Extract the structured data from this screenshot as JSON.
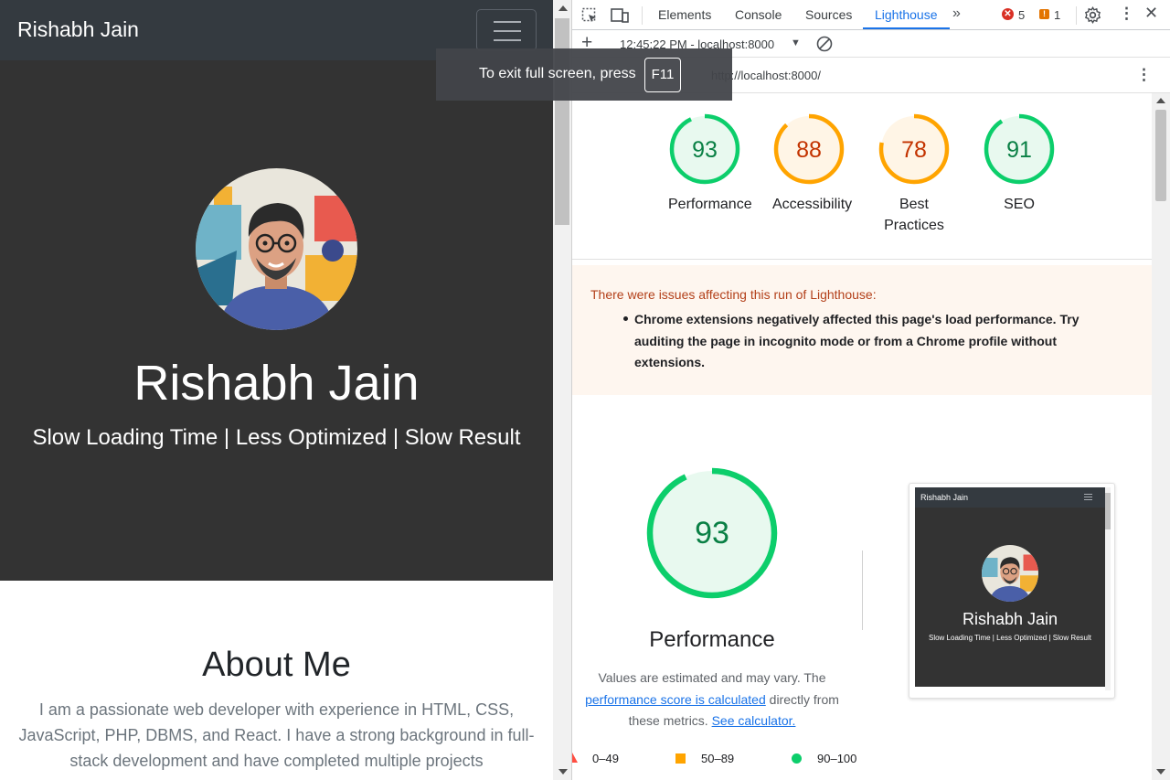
{
  "site": {
    "brand": "Rishabh Jain",
    "hero_name": "Rishabh Jain",
    "hero_tagline": "Slow Loading Time | Less Optimized | Slow Result",
    "about_title": "About Me",
    "about_text": "I am a passionate web developer with experience in HTML, CSS, JavaScript, PHP, DBMS, and React. I have a strong background in full-stack development and have completed multiple projects"
  },
  "fullscreen_toast": {
    "text": "To exit full screen, press",
    "key": "F11"
  },
  "devtools": {
    "tabs": [
      "Elements",
      "Console",
      "Sources",
      "Lighthouse"
    ],
    "active_tab": "Lighthouse",
    "error_count": "5",
    "warning_count": "1",
    "run_label": "12:45:22 PM - localhost:8000",
    "url": "http://localhost:8000/",
    "scores": [
      {
        "label": "Performance",
        "value": 93,
        "color": "#0cce6b"
      },
      {
        "label": "Accessibility",
        "value": 88,
        "color": "#ffa400"
      },
      {
        "label": "Best Practices",
        "value": 78,
        "color": "#ffa400"
      },
      {
        "label": "SEO",
        "value": 91,
        "color": "#0cce6b"
      }
    ],
    "warning_box": {
      "title": "There were issues affecting this run of Lighthouse:",
      "item": "Chrome extensions negatively affected this page's load performance. Try auditing the page in incognito mode or from a Chrome profile without extensions."
    },
    "performance": {
      "score": 93,
      "title": "Performance",
      "note_prefix": "Values are estimated and may vary. The",
      "note_link": "performance score is calculated",
      "note_mid": "directly from these metrics.",
      "calc_link": "See calculator."
    },
    "legend": [
      {
        "range": "0–49",
        "color": "#ff4e42",
        "shape": "triangle"
      },
      {
        "range": "50–89",
        "color": "#ffa400",
        "shape": "square"
      },
      {
        "range": "90–100",
        "color": "#0cce6b",
        "shape": "circle"
      }
    ],
    "thumbnail": {
      "brand": "Rishabh Jain",
      "name": "Rishabh Jain",
      "tagline": "Slow Loading Time | Less Optimized | Slow Result"
    }
  }
}
